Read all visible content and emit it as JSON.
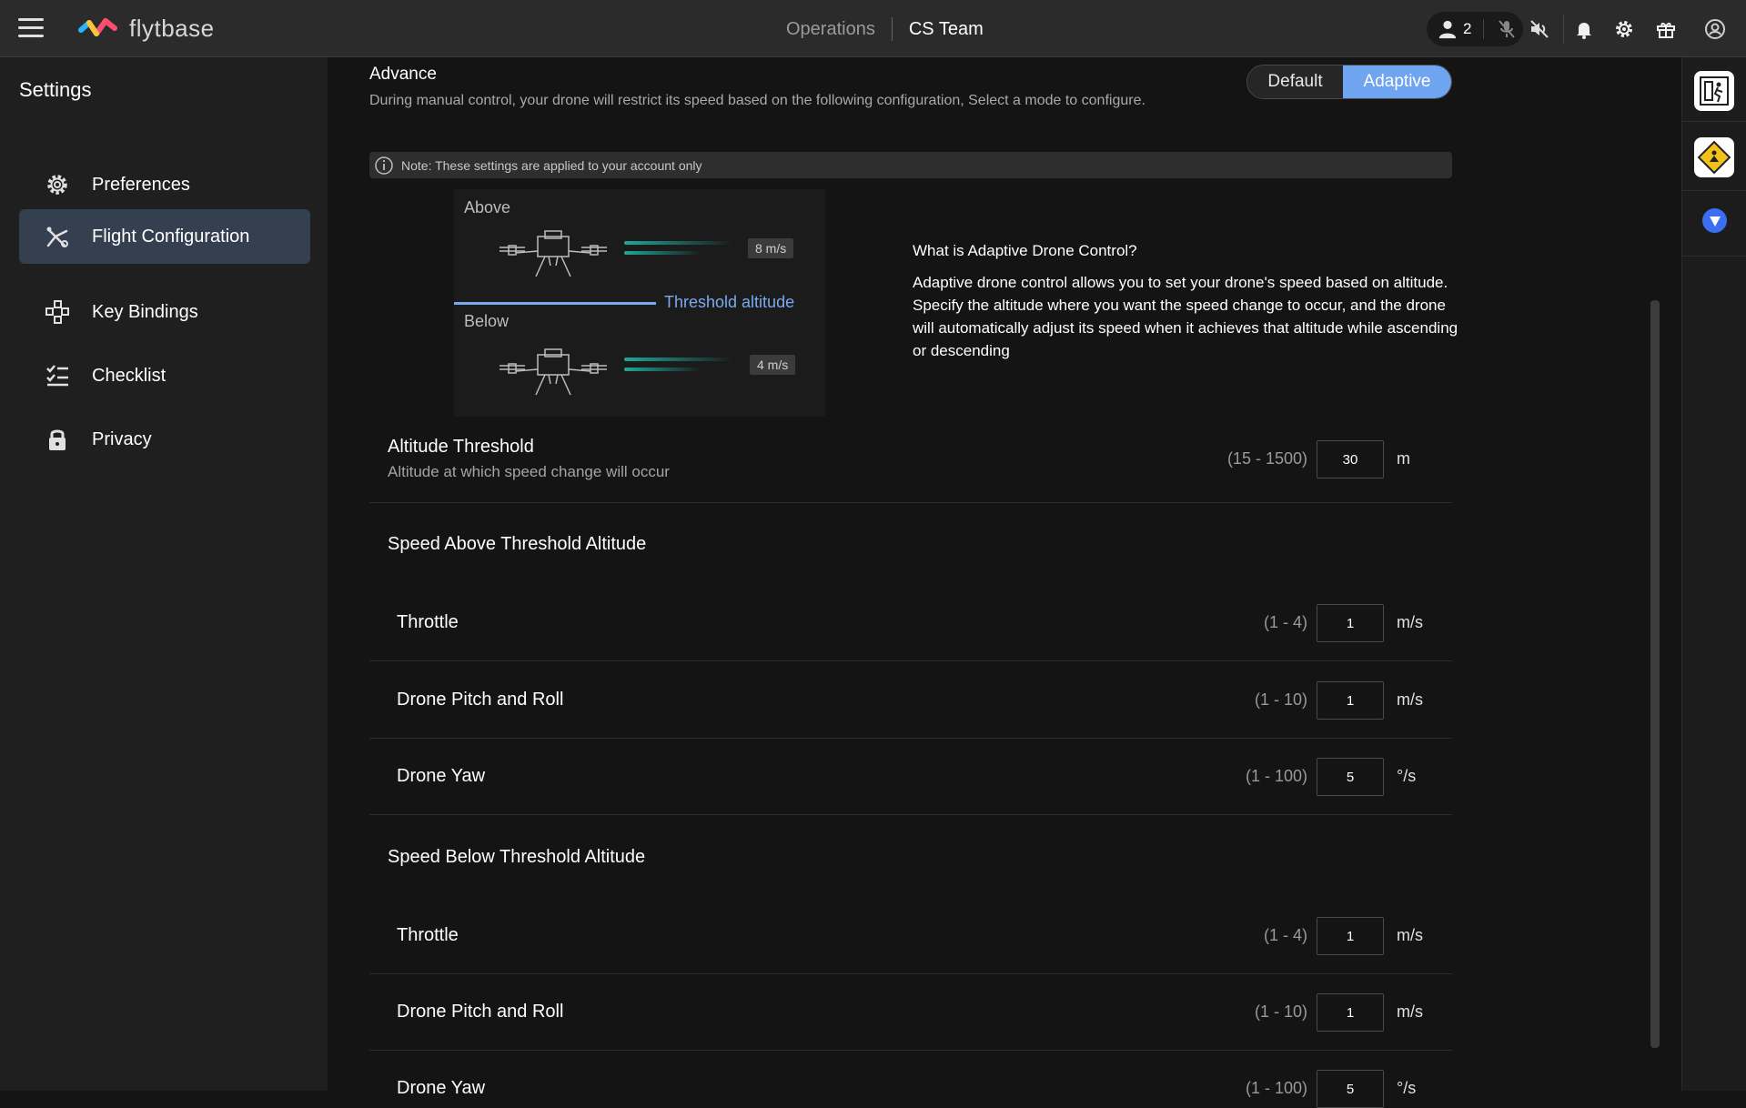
{
  "header": {
    "logo_text": "flytbase",
    "nav_operations": "Operations",
    "nav_team": "CS Team",
    "users_count": "2"
  },
  "sidebar": {
    "title": "Settings",
    "items": [
      {
        "label": "Preferences",
        "icon": "gear-icon",
        "active": false
      },
      {
        "label": "Flight Configuration",
        "icon": "drone-icon",
        "active": true
      },
      {
        "label": "Key Bindings",
        "icon": "key-bindings-icon",
        "active": false
      },
      {
        "label": "Checklist",
        "icon": "checklist-icon",
        "active": false
      },
      {
        "label": "Privacy",
        "icon": "lock-icon",
        "active": false
      }
    ]
  },
  "advance": {
    "title": "Advance",
    "description": "During manual control, your drone will restrict its speed based on the following configuration, Select a mode to configure.",
    "mode_default": "Default",
    "mode_adaptive": "Adaptive",
    "selected_mode": "Adaptive",
    "note": "Note: These settings are applied to your account only"
  },
  "diagram": {
    "above_label": "Above",
    "above_speed": "8 m/s",
    "below_label": "Below",
    "below_speed": "4 m/s",
    "threshold_label": "Threshold altitude"
  },
  "info": {
    "title": "What is Adaptive Drone Control?",
    "body": "Adaptive drone control allows you to set your drone's speed based on altitude. Specify the altitude where you want the speed change to occur, and the drone will automatically adjust its speed when it achieves that altitude while ascending or descending"
  },
  "altitude_threshold": {
    "label": "Altitude Threshold",
    "sublabel": "Altitude at which speed change will occur",
    "range": "(15 - 1500)",
    "value": "30",
    "unit": "m"
  },
  "speed_above": {
    "title": "Speed Above Threshold Altitude",
    "rows": [
      {
        "label": "Throttle",
        "range": "(1 - 4)",
        "value": "1",
        "unit": "m/s"
      },
      {
        "label": "Drone Pitch and Roll",
        "range": "(1 - 10)",
        "value": "1",
        "unit": "m/s"
      },
      {
        "label": "Drone Yaw",
        "range": "(1 - 100)",
        "value": "5",
        "unit": "°/s"
      }
    ]
  },
  "speed_below": {
    "title": "Speed Below Threshold Altitude",
    "rows": [
      {
        "label": "Throttle",
        "range": "(1 - 4)",
        "value": "1",
        "unit": "m/s"
      },
      {
        "label": "Drone Pitch and Roll",
        "range": "(1 - 10)",
        "value": "1",
        "unit": "m/s"
      },
      {
        "label": "Drone Yaw",
        "range": "(1 - 100)",
        "value": "5",
        "unit": "°/s"
      }
    ]
  },
  "colors": {
    "accent": "#6ea4f0",
    "active_nav": "#34404f",
    "speed_bar": "#1fa89a"
  }
}
